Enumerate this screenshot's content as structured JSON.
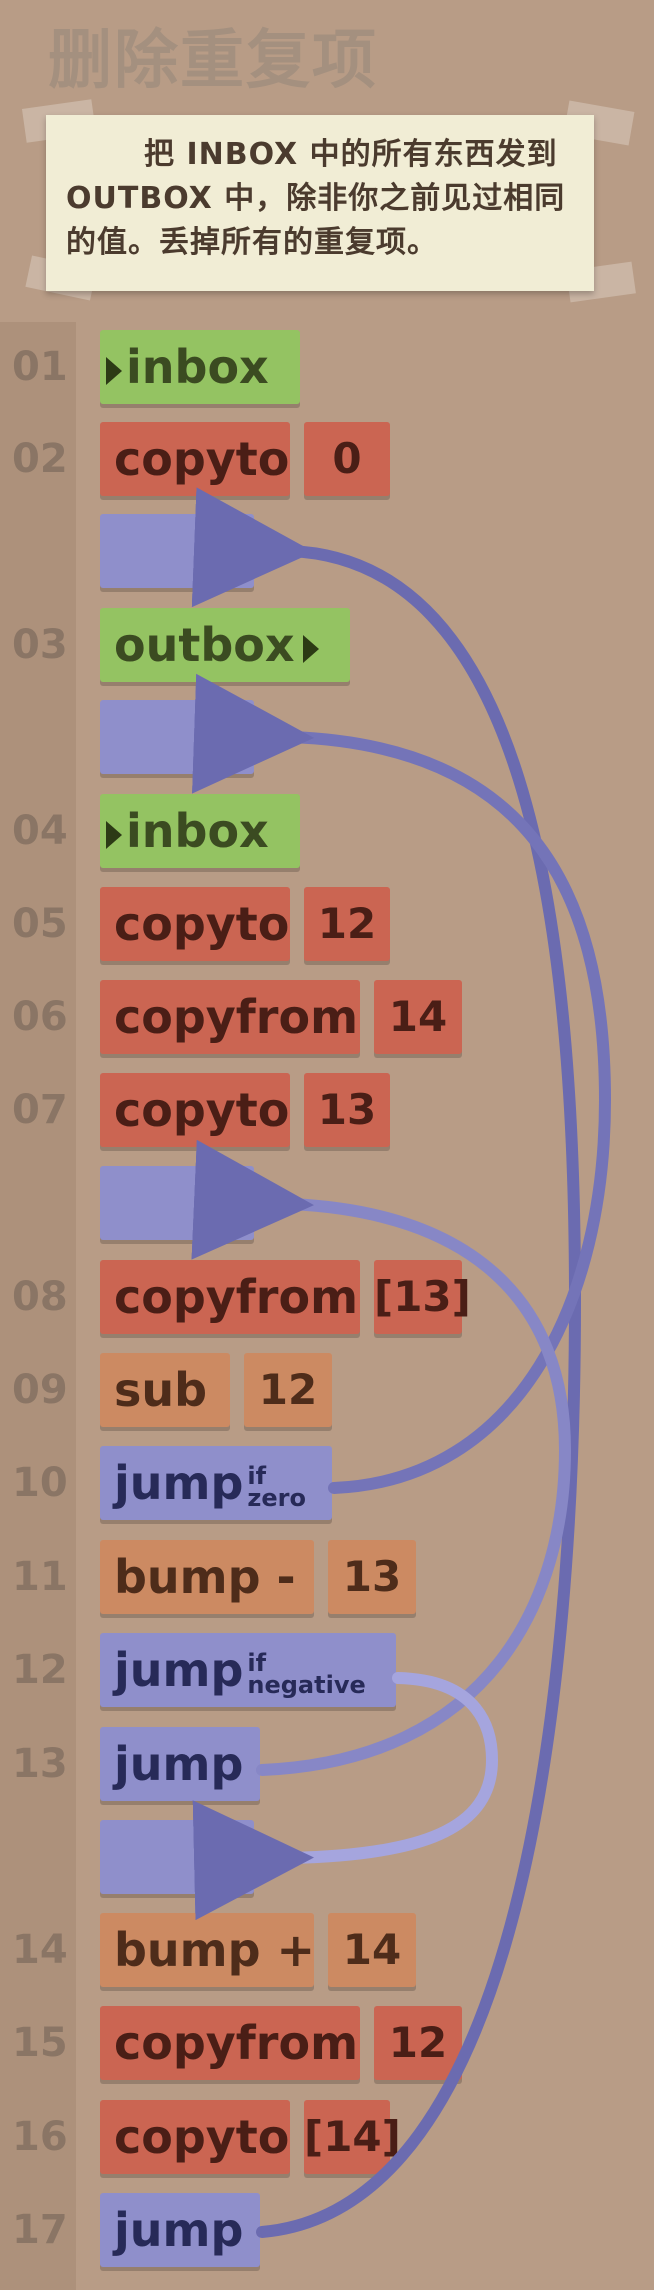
{
  "title": "删除重复项",
  "note": {
    "text": "把 INBOX 中的所有东西发到 OUTBOX 中，除非你之前见过相同的值。丢掉所有的重复项。"
  },
  "program": [
    {
      "line": "01",
      "cmd": "inbox",
      "arg": ""
    },
    {
      "line": "02",
      "cmd": "copyto",
      "arg": "0"
    },
    {
      "line": "03",
      "cmd": "outbox",
      "arg": ""
    },
    {
      "line": "04",
      "cmd": "inbox",
      "arg": ""
    },
    {
      "line": "05",
      "cmd": "copyto",
      "arg": "12"
    },
    {
      "line": "06",
      "cmd": "copyfrom",
      "arg": "14"
    },
    {
      "line": "07",
      "cmd": "copyto",
      "arg": "13"
    },
    {
      "line": "08",
      "cmd": "copyfrom",
      "arg": "[13]"
    },
    {
      "line": "09",
      "cmd": "sub",
      "arg": "12"
    },
    {
      "line": "10",
      "cmd": "jump",
      "sup": "if",
      "subtext": "zero"
    },
    {
      "line": "11",
      "cmd": "bump -",
      "arg": "13"
    },
    {
      "line": "12",
      "cmd": "jump",
      "sup": "if",
      "subtext": "negative"
    },
    {
      "line": "13",
      "cmd": "jump"
    },
    {
      "line": "14",
      "cmd": "bump +",
      "arg": "14"
    },
    {
      "line": "15",
      "cmd": "copyfrom",
      "arg": "12"
    },
    {
      "line": "16",
      "cmd": "copyto",
      "arg": "[14]"
    },
    {
      "line": "17",
      "cmd": "jump"
    }
  ],
  "colors": {
    "io": "#94c362",
    "memory": "#cb6552",
    "math": "#cc8a62",
    "jump": "#8f8fcb",
    "background": "#b89c86"
  }
}
